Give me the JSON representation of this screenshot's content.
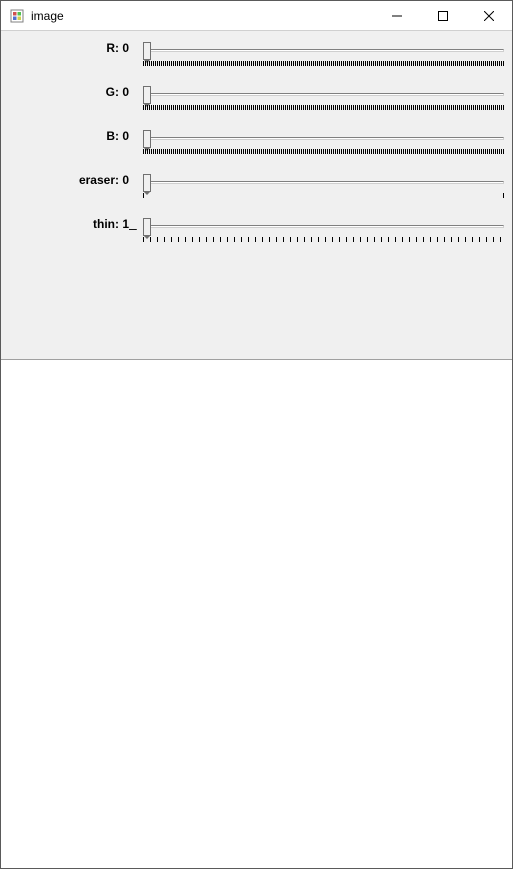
{
  "window": {
    "title": "image",
    "icon": "app-icon",
    "controls": {
      "minimize": "minimize-icon",
      "maximize": "maximize-icon",
      "close": "close-icon"
    }
  },
  "sliders": [
    {
      "name": "R",
      "label": "R: 0",
      "value": 0,
      "min": 0,
      "max": 255,
      "ticks": "dense",
      "has_minus": false
    },
    {
      "name": "G",
      "label": "G: 0",
      "value": 0,
      "min": 0,
      "max": 255,
      "ticks": "dense",
      "has_minus": false
    },
    {
      "name": "B",
      "label": "B: 0",
      "value": 0,
      "min": 0,
      "max": 255,
      "ticks": "dense",
      "has_minus": false
    },
    {
      "name": "eraser",
      "label": "eraser: 0",
      "value": 0,
      "min": 0,
      "max": 1,
      "ticks": "two",
      "has_minus": false
    },
    {
      "name": "thin",
      "label": "thin: 1",
      "value": 1,
      "min": 1,
      "max": 50,
      "ticks": "sparse",
      "has_minus": true
    }
  ]
}
